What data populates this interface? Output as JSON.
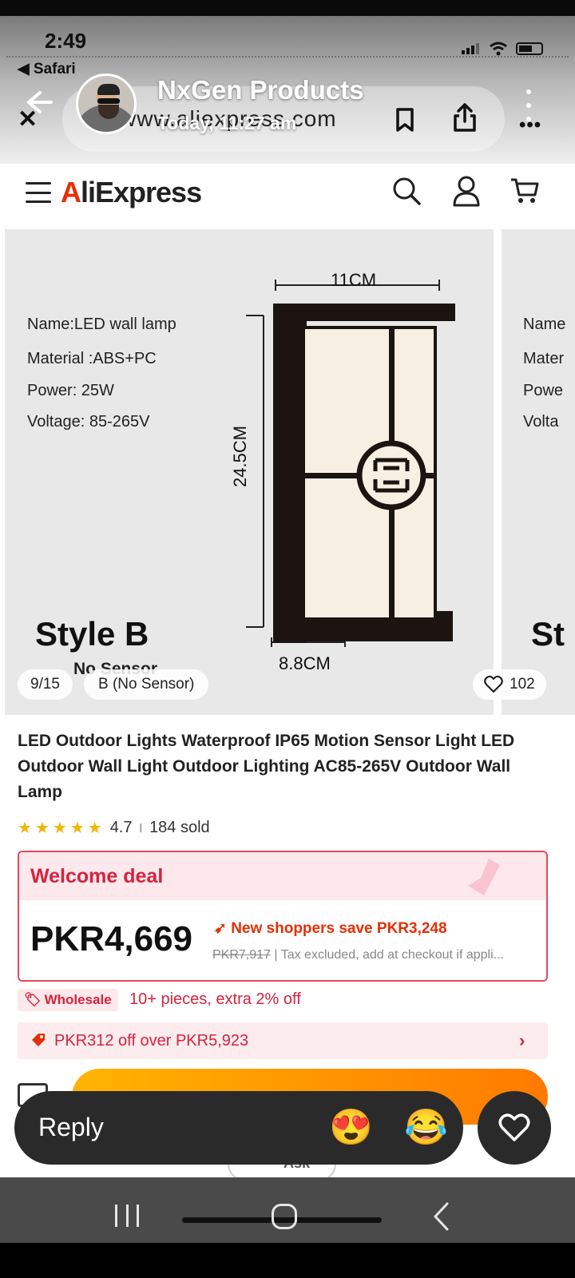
{
  "status_bar": {
    "time": "2:49",
    "back_app": "◀ Safari"
  },
  "browser": {
    "url": "www.aliexpress.com"
  },
  "story": {
    "name": "NxGen Products",
    "timestamp": "Today, 11:27 am"
  },
  "aliexpress": {
    "logo": "AliExpress"
  },
  "gallery": {
    "specs": [
      "Name:LED wall lamp",
      "Material :ABS+PC",
      "Power: 25W",
      "Voltage: 85-265V"
    ],
    "specs_peek": [
      "Name",
      "Mater",
      "Powe",
      "Volta"
    ],
    "style_label": "Style B",
    "style_peek": "St",
    "sensor_ghost": "No Sensor",
    "dimensions": {
      "width": "11CM",
      "height": "24.5CM",
      "depth": "8.8CM"
    },
    "counter": "9/15",
    "variant": "B (No Sensor)",
    "likes": "102"
  },
  "product": {
    "title": "LED Outdoor Lights Waterproof IP65 Motion Sensor Light LED Outdoor Wall Light Outdoor Lighting AC85-265V Outdoor Wall Lamp",
    "rating": "4.7",
    "sold": "184 sold",
    "stars": 5
  },
  "deal": {
    "title": "Welcome deal",
    "price": "PKR4,669",
    "save_text": "New shoppers save PKR3,248",
    "original_price": "PKR7,917",
    "tax_note": "| Tax excluded, add at checkout if appli..."
  },
  "wholesale": {
    "badge": "Wholesale",
    "text": "10+ pieces, extra 2% off"
  },
  "coupon": {
    "text": "PKR312 off over PKR5,923"
  },
  "actions": {
    "ask": "Ask"
  },
  "reply": {
    "placeholder": "Reply",
    "emoji_1": "😍",
    "emoji_2": "😂"
  },
  "colors": {
    "accent": "#e62e04",
    "deal_red": "#d6223d",
    "cta_orange": "#ff9a00"
  }
}
